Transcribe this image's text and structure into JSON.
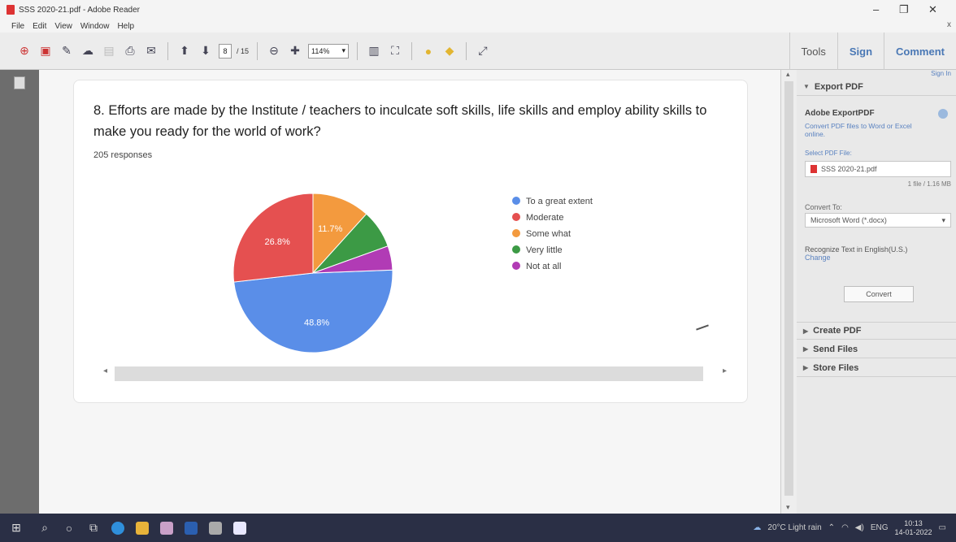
{
  "window": {
    "title": "SSS 2020-21.pdf - Adobe Reader",
    "min": "–",
    "restore": "❐",
    "close": "✕"
  },
  "menu": [
    "File",
    "Edit",
    "View",
    "Window",
    "Help"
  ],
  "menu_close": "x",
  "toolbar": {
    "page_current": "8",
    "page_total": "/ 15",
    "zoom": "114%",
    "tab_tools": "Tools",
    "tab_sign": "Sign",
    "tab_comment": "Comment"
  },
  "survey": {
    "question": "8. Efforts are made by the Institute / teachers to inculcate soft skills, life skills and employ ability skills to make you ready for the world of work?",
    "responses": "205 responses"
  },
  "chart_data": {
    "type": "pie",
    "title": "",
    "slices": [
      {
        "label": "To a great extent",
        "value": 48.8,
        "color": "#5a8ee8",
        "label_shown": "48.8%"
      },
      {
        "label": "Moderate",
        "value": 26.8,
        "color": "#e55050",
        "label_shown": "26.8%"
      },
      {
        "label": "Some what",
        "value": 11.7,
        "color": "#f39a3e",
        "label_shown": "11.7%"
      },
      {
        "label": "Very little",
        "value": 7.8,
        "color": "#3c9a45",
        "label_shown": ""
      },
      {
        "label": "Not at all",
        "value": 4.9,
        "color": "#b13bb5",
        "label_shown": ""
      }
    ],
    "legend_position": "right"
  },
  "right_pane": {
    "sign_in": "Sign In",
    "export_pdf": "Export PDF",
    "adobe_exportpdf": "Adobe ExportPDF",
    "description": "Convert PDF files to Word or Excel online.",
    "select_file_label": "Select PDF File:",
    "file_name": "SSS 2020-21.pdf",
    "file_meta": "1 file / 1.16 MB",
    "convert_to_label": "Convert To:",
    "convert_to_value": "Microsoft Word (*.docx)",
    "ocr_text": "Recognize Text in English(U.S.)",
    "ocr_change": "Change",
    "convert_button": "Convert",
    "create_pdf": "Create PDF",
    "send_files": "Send Files",
    "store_files": "Store Files"
  },
  "taskbar": {
    "weather": "20°C  Light rain",
    "lang": "ENG",
    "time": "10:13",
    "date": "14-01-2022"
  }
}
